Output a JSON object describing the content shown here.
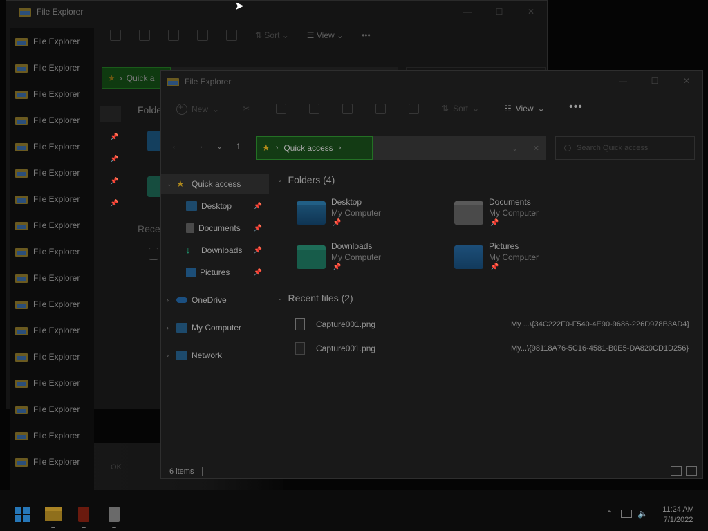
{
  "back_window": {
    "title": "File Explorer",
    "toolbar": {
      "sort": "Sort",
      "view": "View",
      "more": "•••"
    },
    "address_label": "Quick a",
    "folders_head": "Folder",
    "recent_head": "Recent"
  },
  "stack": {
    "items": [
      "File Explorer",
      "File Explorer",
      "File Explorer",
      "File Explorer",
      "File Explorer",
      "File Explorer",
      "File Explorer",
      "File Explorer",
      "File Explorer",
      "File Explorer",
      "File Explorer",
      "File Explorer",
      "File Explorer",
      "File Explorer",
      "File Explorer",
      "File Explorer",
      "File Explorer"
    ]
  },
  "dialog": {
    "ok": "OK"
  },
  "window": {
    "title": "File Explorer",
    "controls": {
      "minimize": "—",
      "maximize": "☐",
      "close": "✕"
    },
    "toolbar": {
      "new": "New",
      "sort": "Sort",
      "view": "View",
      "more": "•••"
    },
    "address": {
      "segment": "Quick access"
    },
    "search": {
      "placeholder": "Search Quick access"
    },
    "nav": {
      "quick_access": "Quick access",
      "items": [
        {
          "label": "Desktop"
        },
        {
          "label": "Documents"
        },
        {
          "label": "Downloads"
        },
        {
          "label": "Pictures"
        }
      ],
      "onedrive": "OneDrive",
      "my_computer": "My Computer",
      "network": "Network"
    },
    "folders_head": "Folders (4)",
    "folders": [
      {
        "name": "Desktop",
        "location": "My Computer"
      },
      {
        "name": "Documents",
        "location": "My Computer"
      },
      {
        "name": "Downloads",
        "location": "My Computer"
      },
      {
        "name": "Pictures",
        "location": "My Computer"
      }
    ],
    "recent_head": "Recent files (2)",
    "recent": [
      {
        "name": "Capture001.png",
        "path": "My ...\\{34C222F0-F540-4E90-9686-226D978B3AD4}"
      },
      {
        "name": "Capture001.png",
        "path": "My...\\{98118A76-5C16-4581-B0E5-DA820CD1D256}"
      }
    ],
    "status": {
      "count": "6 items"
    }
  },
  "taskbar": {
    "time": "11:24 AM",
    "date": "7/1/2022"
  }
}
